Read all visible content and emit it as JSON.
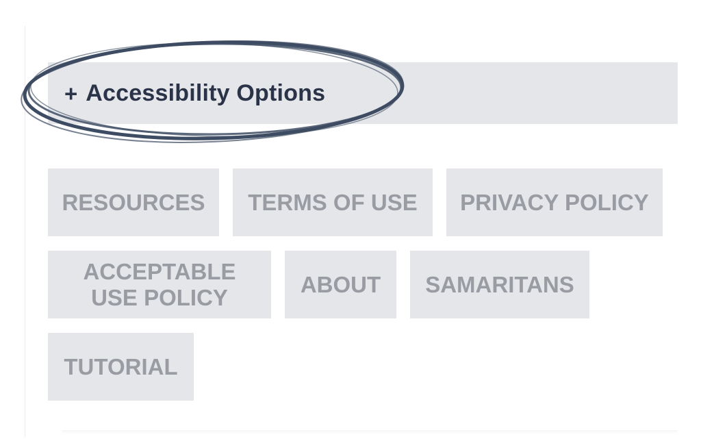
{
  "accessibility": {
    "plus": "+",
    "label": "Accessibility Options"
  },
  "footer_links": [
    {
      "label": "RESOURCES"
    },
    {
      "label": "TERMS OF USE"
    },
    {
      "label": "PRIVACY POLICY"
    },
    {
      "label": "ACCEPTABLE\nUSE POLICY"
    },
    {
      "label": "ABOUT"
    },
    {
      "label": "SAMARITANS"
    },
    {
      "label": "TUTORIAL"
    }
  ],
  "colors": {
    "bar_bg": "#e5e6ea",
    "accent_text": "#2a3347",
    "link_text": "#9a9ca3",
    "annotation_stroke": "#3e4c63"
  },
  "icons": {
    "annotation": "hand-drawn-ellipse-icon"
  }
}
